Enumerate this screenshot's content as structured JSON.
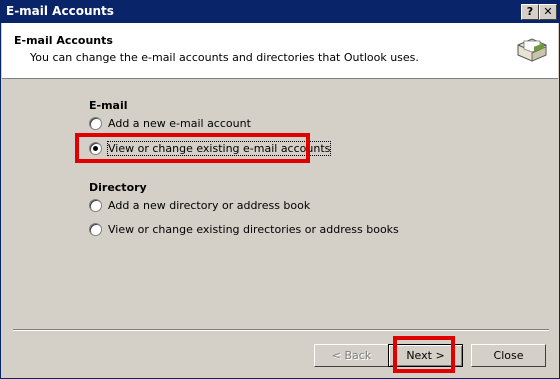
{
  "window": {
    "title": "E-mail Accounts",
    "help_button": "?",
    "close_button": "✕"
  },
  "header": {
    "title": "E-mail Accounts",
    "subtitle": "You can change the e-mail accounts and directories that Outlook uses.",
    "icon": "envelope-card-icon"
  },
  "email_group": {
    "label": "E-mail",
    "options": [
      {
        "label": "Add a new e-mail account",
        "selected": false
      },
      {
        "label": "View or change existing e-mail accounts",
        "selected": true
      }
    ]
  },
  "directory_group": {
    "label": "Directory",
    "options": [
      {
        "label": "Add a new directory or address book",
        "selected": false
      },
      {
        "label": "View or change existing directories or address books",
        "selected": false
      }
    ]
  },
  "buttons": {
    "back": "< Back",
    "next": "Next >",
    "close": "Close"
  },
  "colors": {
    "highlight": "#e10000",
    "titlebar": "#0a246a",
    "dialog": "#d4d0c8"
  }
}
